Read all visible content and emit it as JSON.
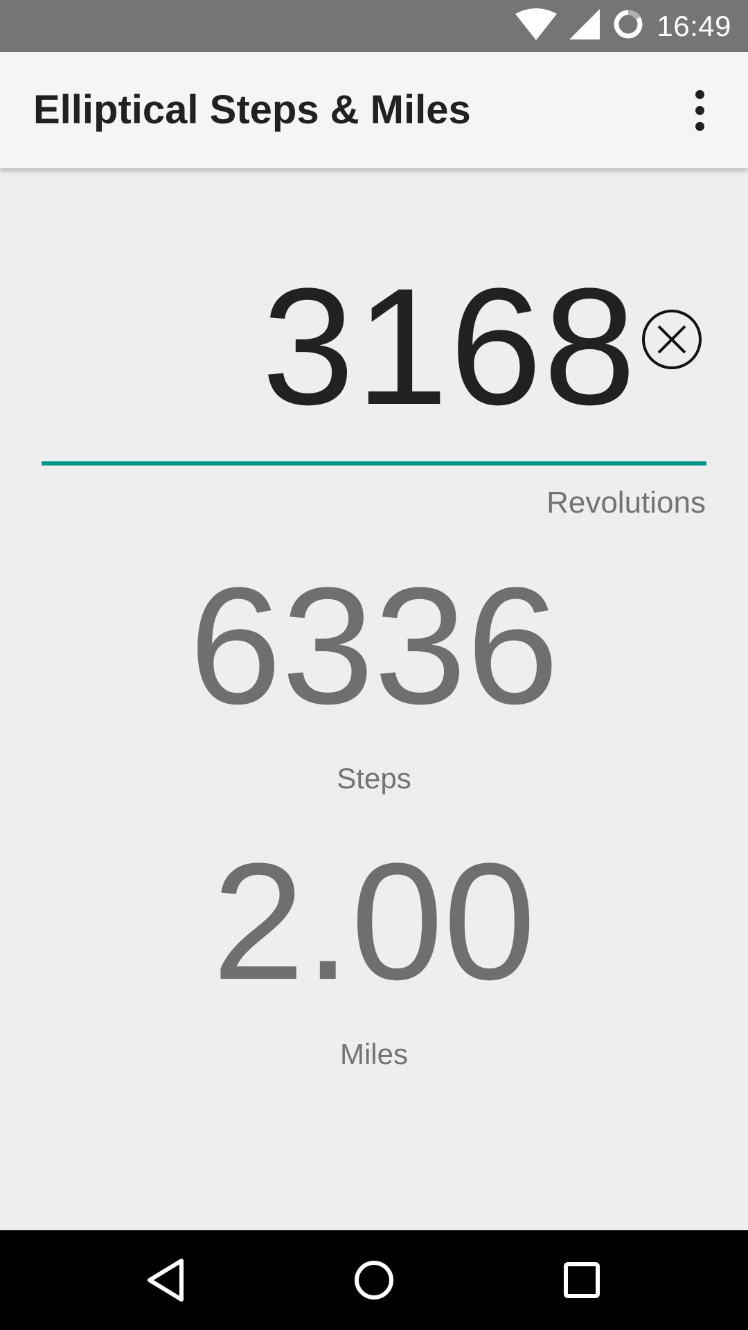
{
  "status_bar": {
    "time": "16:49",
    "icons": [
      "wifi-icon",
      "cell-signal-icon",
      "sync-icon"
    ]
  },
  "app_bar": {
    "title": "Elliptical Steps & Miles",
    "menu_icon": "overflow-menu-icon"
  },
  "revolutions": {
    "value": "3168",
    "label": "Revolutions",
    "clear_icon": "clear-icon"
  },
  "steps": {
    "value": "6336",
    "label": "Steps"
  },
  "miles": {
    "value": "2.00",
    "label": "Miles"
  },
  "nav_bar": {
    "icons": [
      "back-icon",
      "home-icon",
      "recents-icon"
    ]
  },
  "colors": {
    "status_bar": "#757575",
    "app_bar": "#f5f5f5",
    "background": "#eeeeee",
    "accent": "#009688",
    "primary_text": "#212121",
    "secondary_text": "#737373",
    "nav_bar": "#000000"
  }
}
